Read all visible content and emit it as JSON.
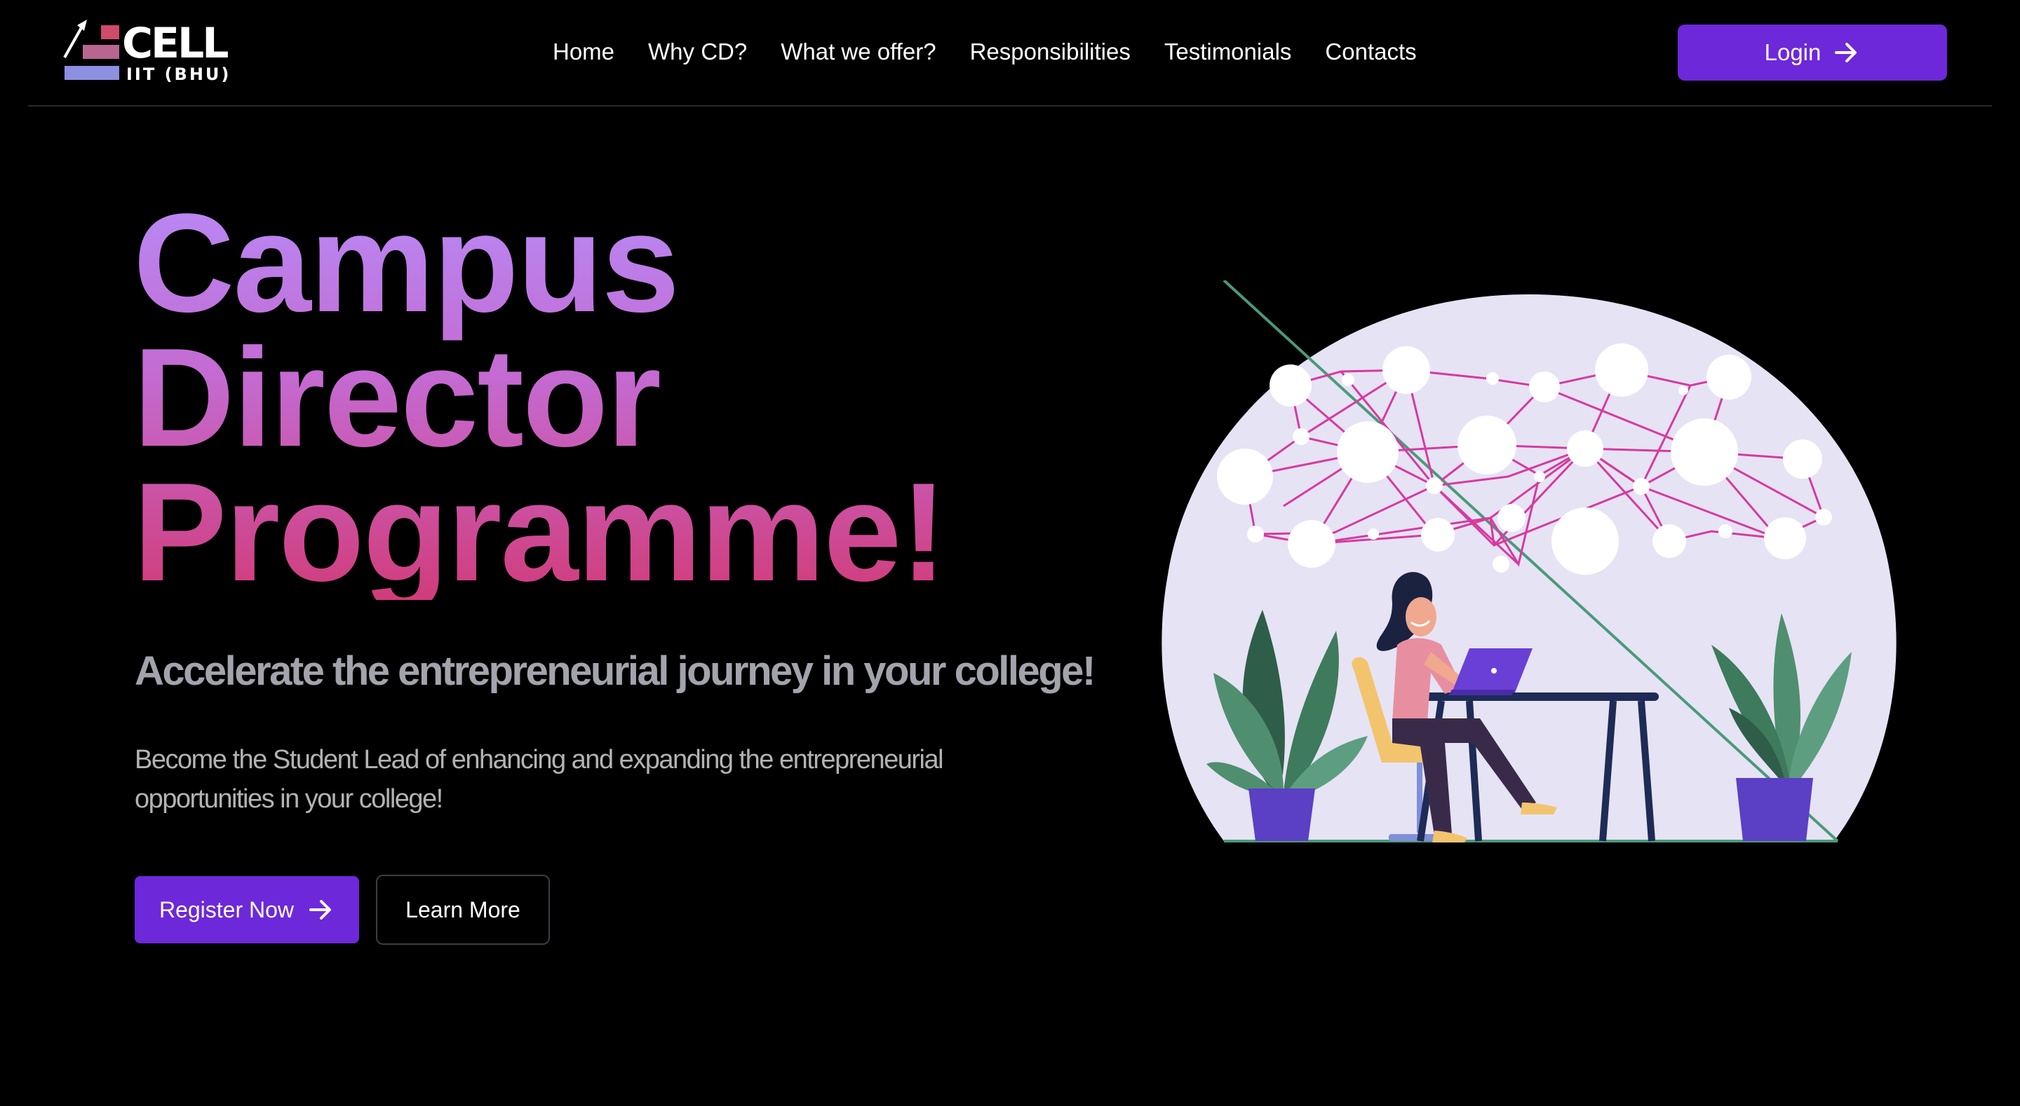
{
  "logo": {
    "word": "CELL",
    "sub": "IIT (BHU)"
  },
  "nav": {
    "links": [
      "Home",
      "Why CD?",
      "What we offer?",
      "Responsibilities",
      "Testimonials",
      "Contacts"
    ],
    "login_label": "Login"
  },
  "hero": {
    "title_lines": [
      "Campus",
      "Director",
      "Programme!"
    ],
    "subtitle": "Accelerate the entrepreneurial journey in your college!",
    "description": "Become the Student Lead of enhancing and expanding the entrepreneurial opportunities in your college!",
    "register_label": "Register Now",
    "learn_label": "Learn More"
  },
  "colors": {
    "accent": "#6d28d9",
    "title_gradient_top": "#b889f5",
    "title_gradient_bottom": "#d13c7a",
    "network_lines": "#d63aa0",
    "illustration_bg": "#e6e3f4"
  },
  "icons": {
    "login_icon": "arrow-right-icon",
    "register_icon": "arrow-right-icon"
  }
}
